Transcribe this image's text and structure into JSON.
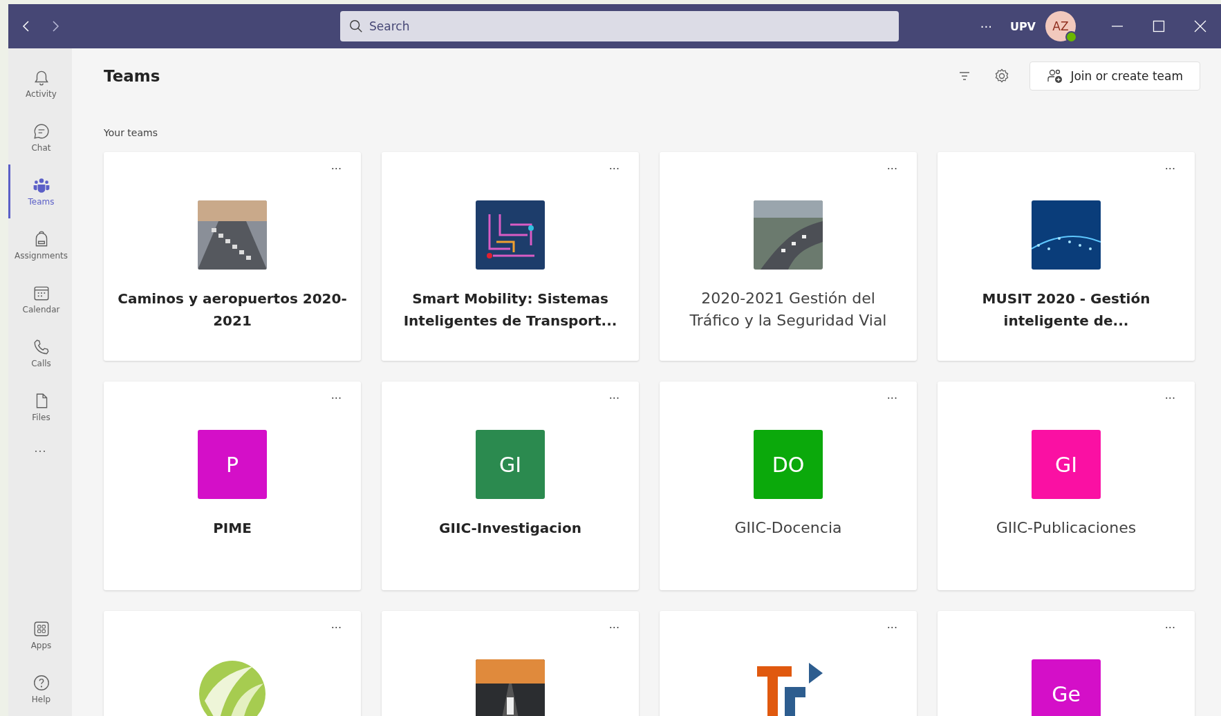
{
  "titlebar": {
    "search": {
      "placeholder": "Search"
    },
    "more": "···",
    "org": "UPV",
    "avatar": {
      "initials": "AZ"
    }
  },
  "rail": {
    "items": [
      {
        "label": "Activity",
        "selected": false
      },
      {
        "label": "Chat",
        "selected": false
      },
      {
        "label": "Teams",
        "selected": true
      },
      {
        "label": "Assignments",
        "selected": false
      },
      {
        "label": "Calendar",
        "selected": false
      },
      {
        "label": "Calls",
        "selected": false
      },
      {
        "label": "Files",
        "selected": false
      }
    ],
    "more": "···",
    "bottom": [
      {
        "label": "Apps",
        "selected": false
      },
      {
        "label": "Help",
        "selected": false
      }
    ]
  },
  "header": {
    "title": "Teams",
    "join_button": "Join or create team"
  },
  "section_label": "Your teams",
  "teams": [
    {
      "menu": "···",
      "name": "Caminos y aeropuertos 2020-2021",
      "unread": true,
      "kind": "photo"
    },
    {
      "menu": "···",
      "name": "Smart Mobility: Sistemas Inteligentes de Transport...",
      "unread": true,
      "kind": "photo"
    },
    {
      "menu": "···",
      "name": "2020-2021 Gestión del Tráfico y la Seguridad Vial",
      "unread": false,
      "kind": "photo"
    },
    {
      "menu": "···",
      "name": "MUSIT 2020 - Gestión inteligente de...",
      "unread": true,
      "kind": "photo"
    },
    {
      "menu": "···",
      "name": "PIME",
      "unread": true,
      "kind": "initials",
      "initials": "P",
      "color": "#d40fc8"
    },
    {
      "menu": "···",
      "name": "GIIC-Investigacion",
      "unread": true,
      "kind": "initials",
      "initials": "GI",
      "color": "#2b8a4f"
    },
    {
      "menu": "···",
      "name": "GIIC-Docencia",
      "unread": false,
      "kind": "initials",
      "initials": "DO",
      "color": "#0ba90b"
    },
    {
      "menu": "···",
      "name": "GIIC-Publicaciones",
      "unread": false,
      "kind": "initials",
      "initials": "GI",
      "color": "#fa10a3"
    },
    {
      "menu": "···",
      "kind": "logo"
    },
    {
      "menu": "···",
      "kind": "photo"
    },
    {
      "menu": "···",
      "kind": "logo"
    },
    {
      "menu": "···",
      "kind": "initials",
      "initials": "Ge",
      "color": "#d40fc8"
    }
  ]
}
